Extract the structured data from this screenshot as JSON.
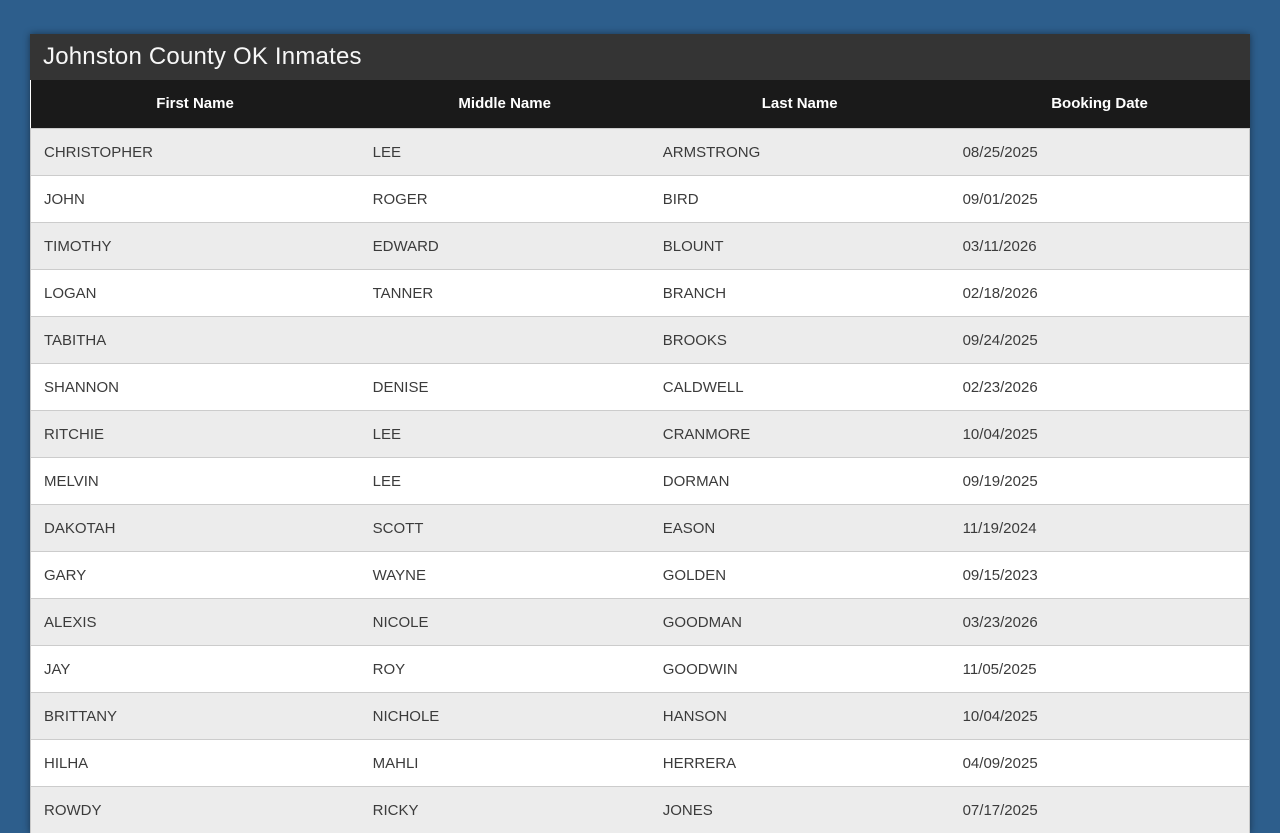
{
  "page": {
    "background_color": "#2d5e8c",
    "title_bar_color": "#343434",
    "header_row_color": "#1a1a1a",
    "alt_row_color": "#ececec",
    "row_color": "#ffffff"
  },
  "header": {
    "title": "Johnston County OK Inmates"
  },
  "table": {
    "columns": [
      "First Name",
      "Middle Name",
      "Last Name",
      "Booking Date"
    ],
    "rows": [
      {
        "first_name": "CHRISTOPHER",
        "middle_name": "LEE",
        "last_name": "ARMSTRONG",
        "booking_date": "08/25/2025"
      },
      {
        "first_name": "JOHN",
        "middle_name": "ROGER",
        "last_name": "BIRD",
        "booking_date": "09/01/2025"
      },
      {
        "first_name": "TIMOTHY",
        "middle_name": "EDWARD",
        "last_name": "BLOUNT",
        "booking_date": "03/11/2026"
      },
      {
        "first_name": "LOGAN",
        "middle_name": "TANNER",
        "last_name": "BRANCH",
        "booking_date": "02/18/2026"
      },
      {
        "first_name": "TABITHA",
        "middle_name": "",
        "last_name": "BROOKS",
        "booking_date": "09/24/2025"
      },
      {
        "first_name": "SHANNON",
        "middle_name": "DENISE",
        "last_name": "CALDWELL",
        "booking_date": "02/23/2026"
      },
      {
        "first_name": "RITCHIE",
        "middle_name": "LEE",
        "last_name": "CRANMORE",
        "booking_date": "10/04/2025"
      },
      {
        "first_name": "MELVIN",
        "middle_name": "LEE",
        "last_name": "DORMAN",
        "booking_date": "09/19/2025"
      },
      {
        "first_name": "DAKOTAH",
        "middle_name": "SCOTT",
        "last_name": "EASON",
        "booking_date": "11/19/2024"
      },
      {
        "first_name": "GARY",
        "middle_name": "WAYNE",
        "last_name": "GOLDEN",
        "booking_date": "09/15/2023"
      },
      {
        "first_name": "ALEXIS",
        "middle_name": "NICOLE",
        "last_name": "GOODMAN",
        "booking_date": "03/23/2026"
      },
      {
        "first_name": "JAY",
        "middle_name": "ROY",
        "last_name": "GOODWIN",
        "booking_date": "11/05/2025"
      },
      {
        "first_name": "BRITTANY",
        "middle_name": "NICHOLE",
        "last_name": "HANSON",
        "booking_date": "10/04/2025"
      },
      {
        "first_name": "HILHA",
        "middle_name": "MAHLI",
        "last_name": "HERRERA",
        "booking_date": "04/09/2025"
      },
      {
        "first_name": "ROWDY",
        "middle_name": "RICKY",
        "last_name": "JONES",
        "booking_date": "07/17/2025"
      }
    ]
  }
}
